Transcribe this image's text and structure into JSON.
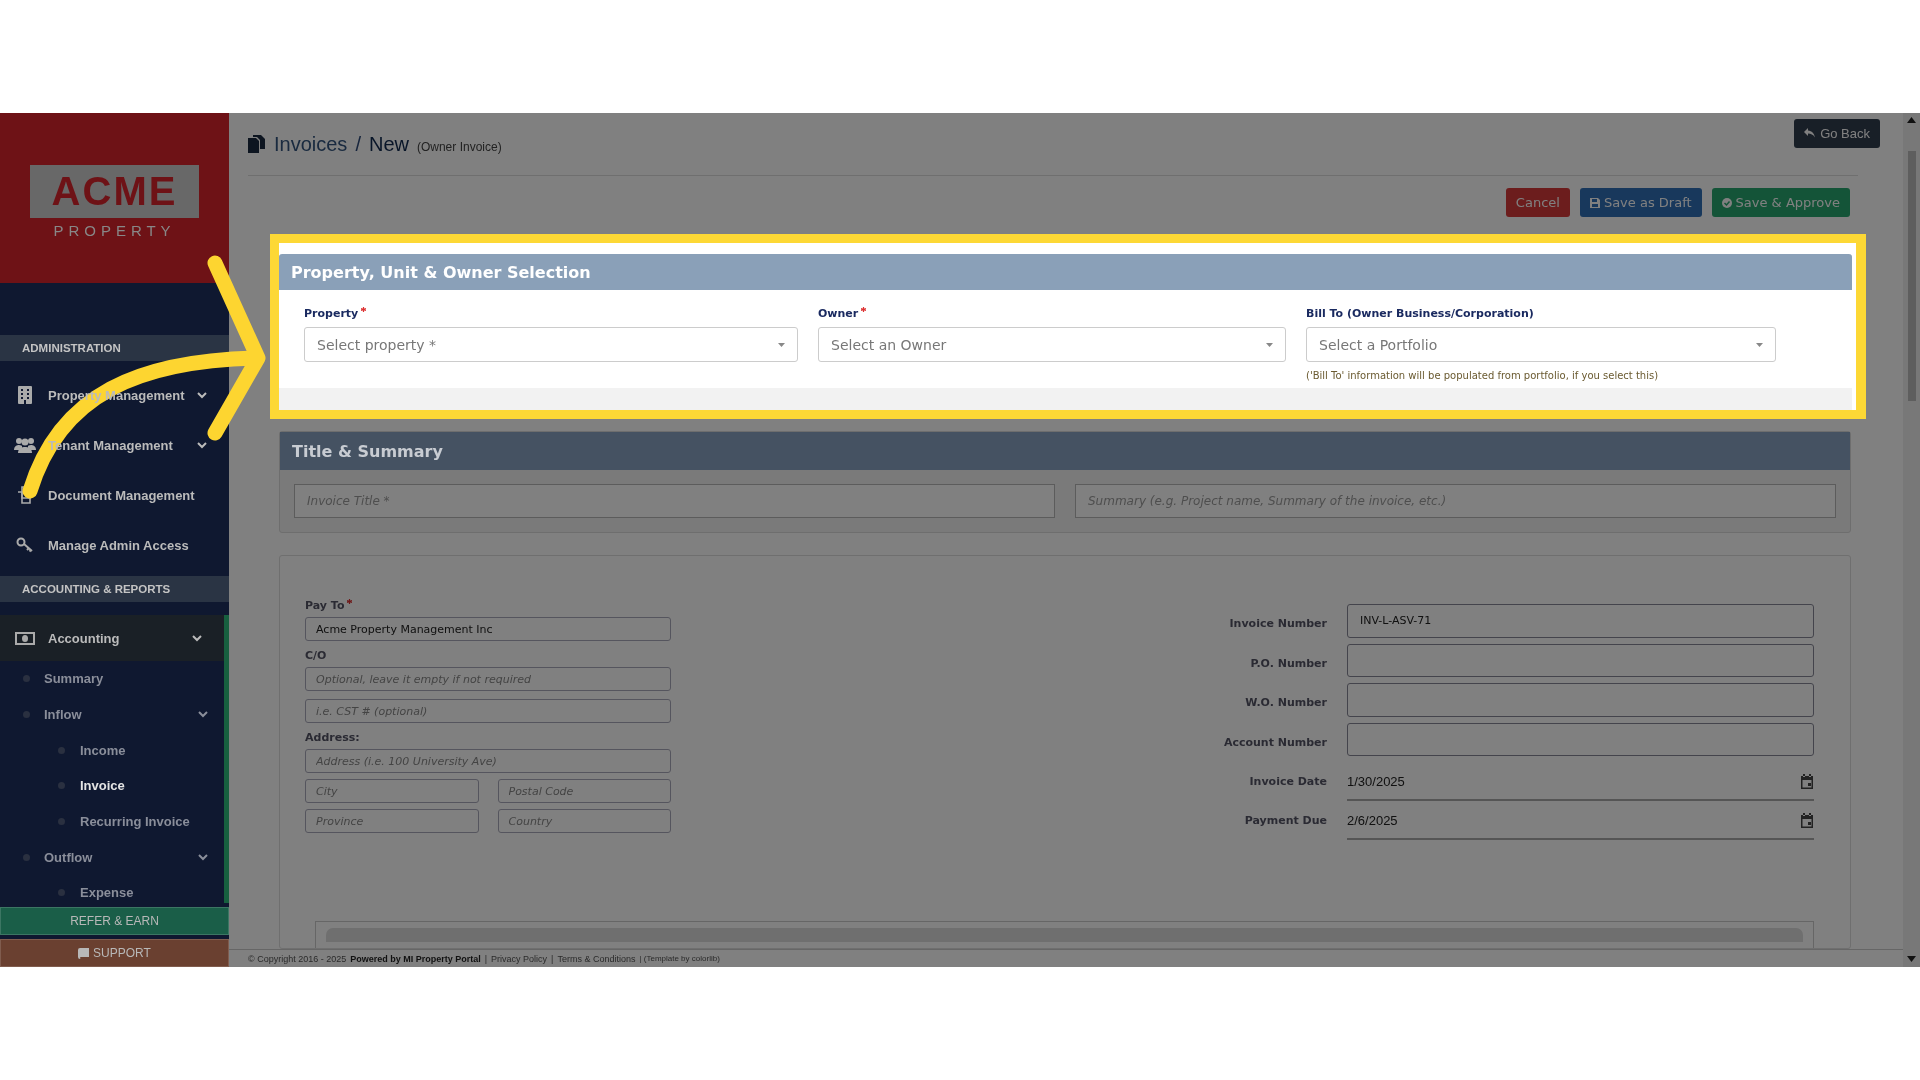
{
  "logo": {
    "name": "ACME",
    "tagline": "PROPERTY"
  },
  "sidebar": {
    "sections": [
      {
        "heading": "ADMINISTRATION",
        "items": [
          {
            "label": "Property Management",
            "submenu": true,
            "selected": false
          },
          {
            "label": "Tenant Management",
            "submenu": true,
            "selected": false
          },
          {
            "label": "Document Management",
            "submenu": false,
            "selected": false
          },
          {
            "label": "Manage Admin Access",
            "submenu": false,
            "selected": false
          }
        ]
      },
      {
        "heading": "ACCOUNTING & REPORTS",
        "items": [
          {
            "label": "Accounting",
            "submenu": true,
            "selected": true,
            "expanded": true,
            "children": [
              {
                "label": "Summary",
                "selected": false,
                "submenu": false
              },
              {
                "label": "Inflow",
                "selected": false,
                "submenu": true,
                "expanded": true,
                "children": [
                  {
                    "label": "Income",
                    "selected": false
                  },
                  {
                    "label": "Invoice",
                    "selected": true
                  },
                  {
                    "label": "Recurring Invoice",
                    "selected": false
                  }
                ]
              },
              {
                "label": "Outflow",
                "selected": false,
                "submenu": true,
                "expanded": true,
                "children": [
                  {
                    "label": "Expense",
                    "selected": false
                  }
                ]
              }
            ]
          }
        ]
      }
    ],
    "buttons": [
      {
        "label": "REFER & EARN",
        "kind": "refer"
      },
      {
        "label": "SUPPORT",
        "kind": "support"
      }
    ]
  },
  "header": {
    "breadcrumb": {
      "section": "Invoices",
      "separator": "/",
      "page": "New",
      "note": "(Owner Invoice)"
    },
    "go_back": "Go Back",
    "actions": [
      {
        "label": "Cancel",
        "kind": "danger"
      },
      {
        "label": "Save as Draft",
        "kind": "primary"
      },
      {
        "label": "Save & Approve",
        "kind": "success"
      }
    ]
  },
  "selection_panel": {
    "title": "Property, Unit & Owner Selection",
    "fields": [
      {
        "label": "Property",
        "required": true,
        "placeholder": "Select property *"
      },
      {
        "label": "Owner",
        "required": true,
        "placeholder": "Select an Owner"
      },
      {
        "label": "Bill To (Owner Business/Corporation)",
        "required": false,
        "placeholder": "Select a Portfolio",
        "help": "('Bill To' information will be populated from portfolio, if you select this)"
      }
    ]
  },
  "title_summary": {
    "title": "Title & Summary",
    "fields": [
      {
        "placeholder": "Invoice Title *"
      },
      {
        "placeholder": "Summary (e.g. Project name, Summary of the invoice, etc.)"
      }
    ]
  },
  "pay_to": {
    "label": "Pay To",
    "required": true,
    "value": "Acme Property Management Inc",
    "co_label": "C/O",
    "co_placeholder": "Optional, leave it empty if not required",
    "tax_placeholder": "i.e. CST # (optional)",
    "address_label": "Address:",
    "address_fields": [
      {
        "placeholder": "Address (i.e. 100 University Ave)",
        "kind": "wide"
      },
      {
        "placeholder": "City",
        "kind": "half"
      },
      {
        "placeholder": "Postal Code",
        "kind": "half"
      },
      {
        "placeholder": "Province",
        "kind": "half"
      },
      {
        "placeholder": "Country",
        "kind": "half"
      }
    ]
  },
  "invoice_details": [
    {
      "label": "Invoice Number",
      "kind": "text",
      "value": "INV-L-ASV-71"
    },
    {
      "label": "P.O. Number",
      "kind": "text"
    },
    {
      "label": "W.O. Number",
      "kind": "text"
    },
    {
      "label": "Account Number",
      "kind": "text"
    },
    {
      "label": "Invoice Date",
      "kind": "date",
      "value": "1/30/2025"
    },
    {
      "label": "Payment Due",
      "kind": "date",
      "value": "2/6/2025"
    }
  ],
  "footer": {
    "copyright": "© Copyright 2016 - 2025",
    "powered_by": "Powered by MI Property Portal",
    "separator": "|",
    "links": [
      "Privacy Policy",
      "Terms & Conditions"
    ],
    "credit": "(Template by colorlib)"
  }
}
